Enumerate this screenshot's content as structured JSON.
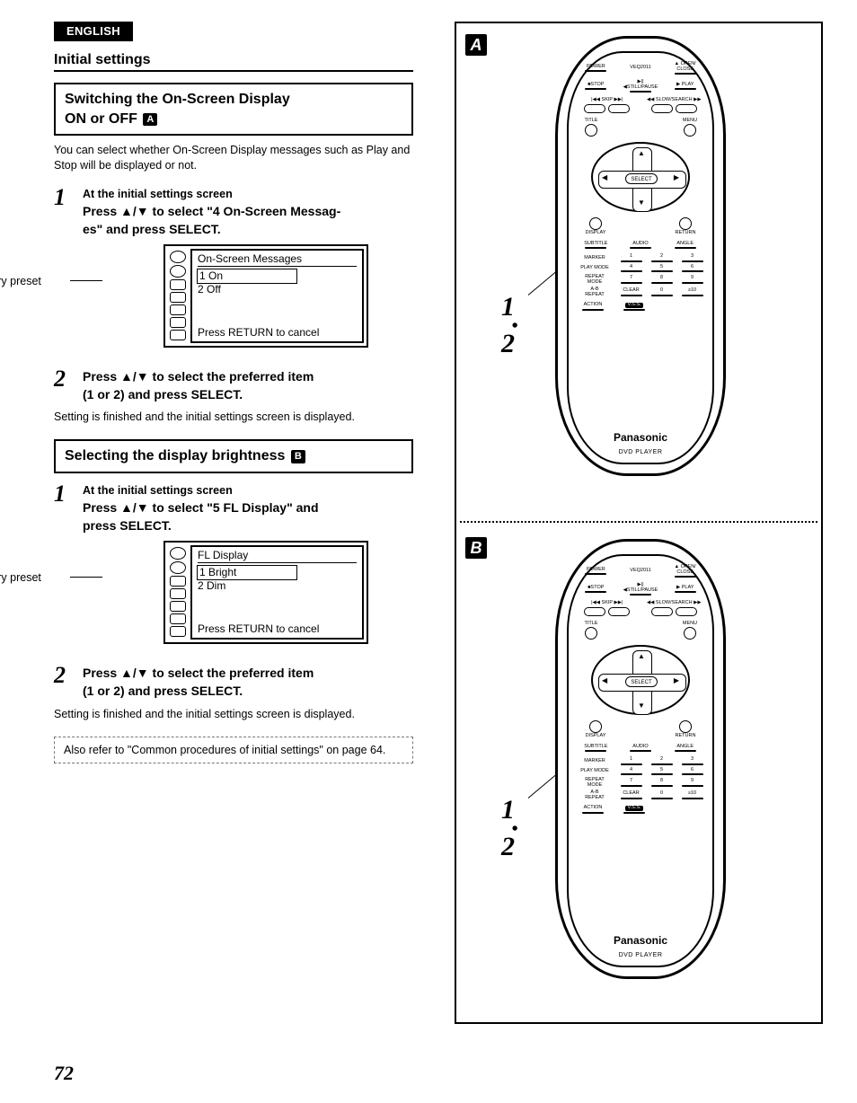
{
  "lang_tag": "ENGLISH",
  "section_title": "Initial settings",
  "block1": {
    "heading_line1": "Switching the On-Screen Display",
    "heading_line2_pre": "ON or OFF ",
    "heading_chip": "A",
    "intro": "You can select whether On-Screen Display messages such as Play and Stop will be displayed or not.",
    "step1_num": "1",
    "step1_line1": "At the initial settings screen",
    "step1_line2a": "Press ",
    "step1_arrows": "▲/▼",
    "step1_line2b": " to select \"4 On-Screen Messag-",
    "step1_line3": "es\" and press SELECT.",
    "factory": "Factory preset",
    "osd_title": "On-Screen Messages",
    "osd_opt1": "1 On",
    "osd_opt2": "2 Off",
    "osd_footer": "Press RETURN to cancel",
    "step2_num": "2",
    "step2_a": "Press ",
    "step2_arrows": "▲/▼",
    "step2_b": " to select the preferred item",
    "step2_c": "(1 or 2) and press SELECT.",
    "after": "Setting is finished and the initial settings screen is displayed."
  },
  "block2": {
    "heading": "Selecting the display brightness ",
    "heading_chip": "B",
    "step1_num": "1",
    "step1_line1": "At the initial settings screen",
    "step1_line2a": "Press ",
    "step1_arrows": "▲/▼",
    "step1_line2b": " to select \"5 FL Display\" and",
    "step1_line3": "press SELECT.",
    "factory": "Factory preset",
    "osd_title": "FL Display",
    "osd_opt1": "1 Bright",
    "osd_opt2": "2 Dim",
    "osd_footer": "Press RETURN to cancel",
    "step2_num": "2",
    "step2_a": "Press ",
    "step2_arrows": "▲/▼",
    "step2_b": " to select the preferred item",
    "step2_c": "(1 or 2) and press SELECT.",
    "after": "Setting is finished and the initial settings screen is displayed.",
    "note": "Also refer to \"Common procedures of initial settings\" on page 64."
  },
  "figure": {
    "chip_a": "A",
    "chip_b": "B",
    "steps_a": "1",
    "steps_a2": "2",
    "steps_b": "1",
    "steps_b2": "2"
  },
  "remote": {
    "model": "VEQ2011",
    "power": "POWER",
    "open": "▲ OPEN/\nCLOSE",
    "stop": "■STOP",
    "still": "▶||◀STILL/PAUSE",
    "play": "▶ PLAY",
    "skip_l": "|◀◀ SKIP ▶▶|",
    "slow": "◀◀ SLOW/SEARCH ▶▶",
    "title": "TITLE",
    "menu": "MENU",
    "select": "SELECT",
    "display": "DISPLAY",
    "return": "RETURN",
    "subtitle": "SUBTITLE",
    "audio": "AUDIO",
    "angle": "ANGLE",
    "marker": "MARKER",
    "playmode": "PLAY MODE",
    "repeat": "REPEAT\nMODE",
    "ab": "A-B\nREPEAT",
    "clear": "CLEAR",
    "gte10": "≥10",
    "action": "ACTION",
    "vss": "V.S.S.",
    "brand": "Panasonic",
    "brand_sub": "DVD PLAYER",
    "n1": "1",
    "n2": "2",
    "n3": "3",
    "n4": "4",
    "n5": "5",
    "n6": "6",
    "n7": "7",
    "n8": "8",
    "n9": "9",
    "n0": "0"
  },
  "page_number": "72"
}
